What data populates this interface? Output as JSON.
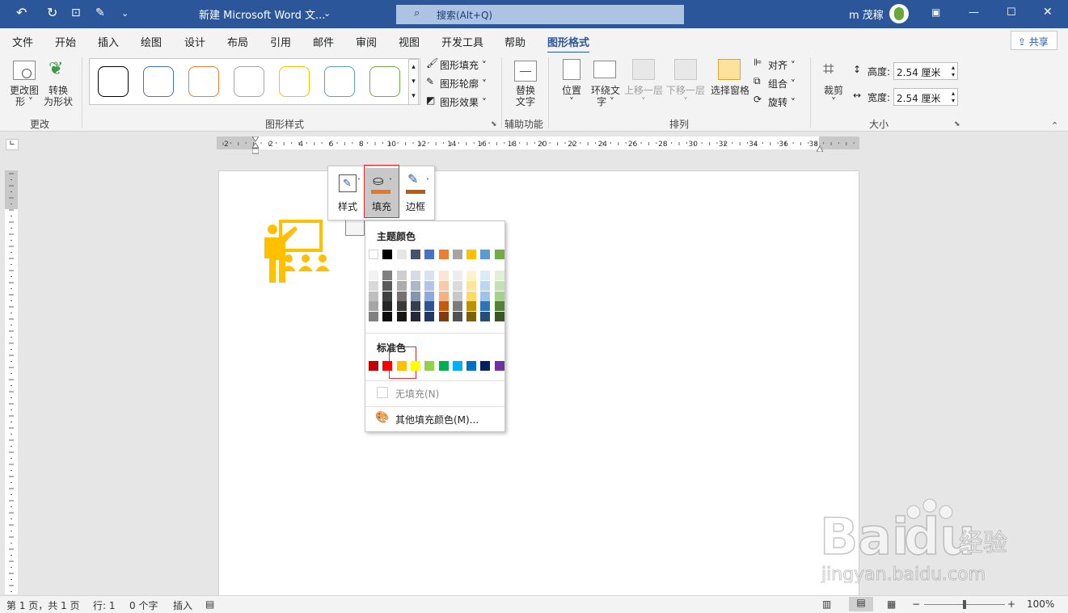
{
  "titlebar": {
    "title": "新建 Microsoft Word 文...",
    "search_text": "搜索(Alt+Q)",
    "user": "m 茂稼",
    "bg": "#2b579a"
  },
  "tabs": [
    "文件",
    "开始",
    "插入",
    "绘图",
    "设计",
    "布局",
    "引用",
    "邮件",
    "审阅",
    "视图",
    "开发工具",
    "帮助",
    "图形格式"
  ],
  "share": "共享",
  "ribbon": {
    "change_shape": "更改图\n形 ˅",
    "convert": "转换\n为形状",
    "group_change": "更改",
    "styles_group": "图形样式",
    "fill": "图形填充 ˅",
    "outline": "图形轮廓 ˅",
    "effect": "图形效果 ˅",
    "alt_text": "替换\n文字",
    "group_access": "辅助功能",
    "position": "位置\n˅",
    "wrap": "环绕文\n字 ˅",
    "bring_forward": "上移一层\n˅",
    "send_backward": "下移一层\n˅",
    "selection_pane": "选择窗格",
    "align": "对齐 ˅",
    "group": "组合 ˅",
    "rotate": "旋转 ˅",
    "group_arrange": "排列",
    "crop": "裁剪\n˅",
    "height_label": "高度:",
    "height_value": "2.54 厘米",
    "width_label": "宽度:",
    "width_value": "2.54 厘米",
    "group_size": "大小",
    "swatch_colors": [
      "#000000",
      "#4472c4",
      "#ed7d31",
      "#a5a5a5",
      "#ffc000",
      "#5b9bd5",
      "#70ad47"
    ]
  },
  "ruler_labels": [
    "2",
    "2",
    "4",
    "6",
    "8",
    "10",
    "12",
    "14",
    "16",
    "18",
    "20",
    "22",
    "24",
    "26",
    "28",
    "30",
    "32",
    "34",
    "36",
    "38"
  ],
  "minitoolbar": {
    "style": "样式",
    "fill": "填充",
    "border": "边框"
  },
  "colormenu": {
    "theme_title": "主题颜色",
    "theme_colors": [
      "#ffffff",
      "#000000",
      "#e7e6e6",
      "#44546a",
      "#4472c4",
      "#ed7d31",
      "#a5a5a5",
      "#ffc000",
      "#5b9bd5",
      "#70ad47"
    ],
    "theme_shades": [
      [
        "#f2f2f2",
        "#d9d9d9",
        "#bfbfbf",
        "#a6a6a6",
        "#808080"
      ],
      [
        "#808080",
        "#595959",
        "#404040",
        "#262626",
        "#0d0d0d"
      ],
      [
        "#d0cece",
        "#aeabab",
        "#757171",
        "#3a3838",
        "#171616"
      ],
      [
        "#d6dce4",
        "#adb9ca",
        "#8496b0",
        "#333f4f",
        "#222a35"
      ],
      [
        "#d9e2f3",
        "#b4c6e7",
        "#8eaadb",
        "#2f5496",
        "#1f3864"
      ],
      [
        "#fbe5d5",
        "#f7caac",
        "#f4b183",
        "#c55a11",
        "#833c0b"
      ],
      [
        "#ededed",
        "#dbdbdb",
        "#c9c9c9",
        "#7b7b7b",
        "#525252"
      ],
      [
        "#fff2cc",
        "#fee599",
        "#ffd966",
        "#bf9000",
        "#7f6000"
      ],
      [
        "#deebf6",
        "#bdd7ee",
        "#9dc3e6",
        "#2e75b5",
        "#1f4e79"
      ],
      [
        "#e2efd9",
        "#c5e0b3",
        "#a8d08d",
        "#538135",
        "#375623"
      ]
    ],
    "standard_title": "标准色",
    "standard_colors": [
      "#c00000",
      "#ff0000",
      "#ffc000",
      "#ffff00",
      "#92d050",
      "#00b050",
      "#00b0f0",
      "#0070c0",
      "#002060",
      "#7030a0"
    ],
    "no_fill": "无填充(N)",
    "more_colors": "其他填充颜色(M)..."
  },
  "status": {
    "page": "第 1 页，共 1 页",
    "line": "行: 1",
    "words": "0 个字",
    "mode": "插入",
    "zoom": "100%",
    "zoom_percent": 100
  },
  "icon_color": "#ffc000",
  "watermark": {
    "brand": "Bai du 经验",
    "url": "jingyan.baidu.com"
  }
}
